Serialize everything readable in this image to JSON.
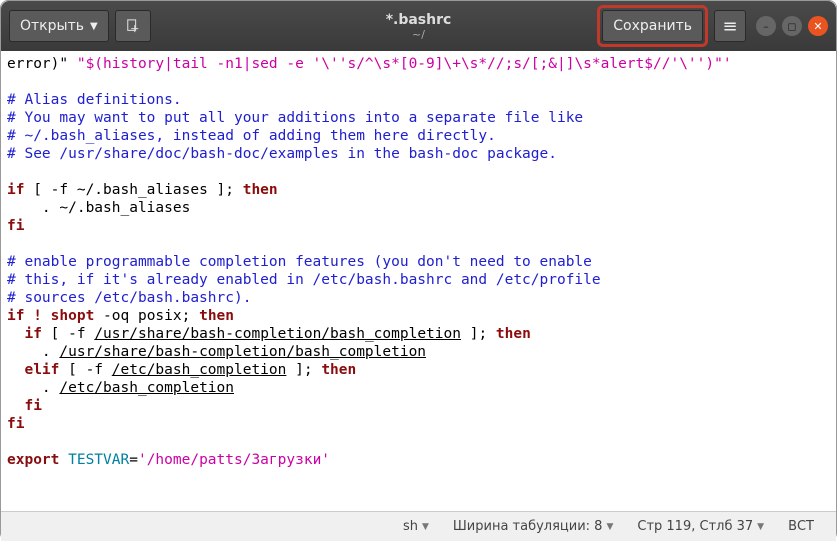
{
  "header": {
    "open_label": "Открыть",
    "title": "*.bashrc",
    "subtitle": "~/",
    "save_label": "Сохранить"
  },
  "editor": {
    "line1_pre": "error)\" ",
    "line1_str": "\"$(history|tail -n1|sed -e '\\''s/^\\s*[0-9]\\+\\s*//;s/[;&|]\\s*alert$//'\\'')\"'",
    "cmt1": "# Alias definitions.",
    "cmt2": "# You may want to put all your additions into a separate file like",
    "cmt3": "# ~/.bash_aliases, instead of adding them here directly.",
    "cmt4": "# See /usr/share/doc/bash-doc/examples in the bash-doc package.",
    "kw_if": "if",
    "kw_then": "then",
    "kw_fi": "fi",
    "kw_elif": "elif",
    "kw_shopt": "shopt",
    "kw_export": "export",
    "kw_bang": "!",
    "cond1": " [ -f ~/.bash_aliases ]; ",
    "body1": "    . ~/.bash_aliases",
    "cmt5": "# enable programmable completion features (you don't need to enable",
    "cmt6": "# this, if it's already enabled in /etc/bash.bashrc and /etc/profile",
    "cmt7": "# sources /etc/bash.bashrc).",
    "shopt_args": " -oq posix; ",
    "cond2a": " [ -f ",
    "cond2b": " ]; ",
    "path1": "/usr/share/bash-completion/bash_completion",
    "body2_pre": "    . ",
    "path2": "/usr/share/bash-completion/bash_completion",
    "cond3a": " [ -f ",
    "path3": "/etc/bash_completion",
    "cond3b": " ]; ",
    "body3_pre": "    . ",
    "path4": "/etc/bash_completion",
    "inner_fi_pad": "  ",
    "inner_if_pad": "  ",
    "inner_elif_pad": "  ",
    "export_var": " TESTVAR",
    "export_eq": "=",
    "export_val": "'/home/patts/Загрузки'"
  },
  "statusbar": {
    "lang": "sh",
    "tabwidth": "Ширина табуляции: 8",
    "cursor": "Стр 119, Стлб 37",
    "mode": "ВСТ"
  }
}
